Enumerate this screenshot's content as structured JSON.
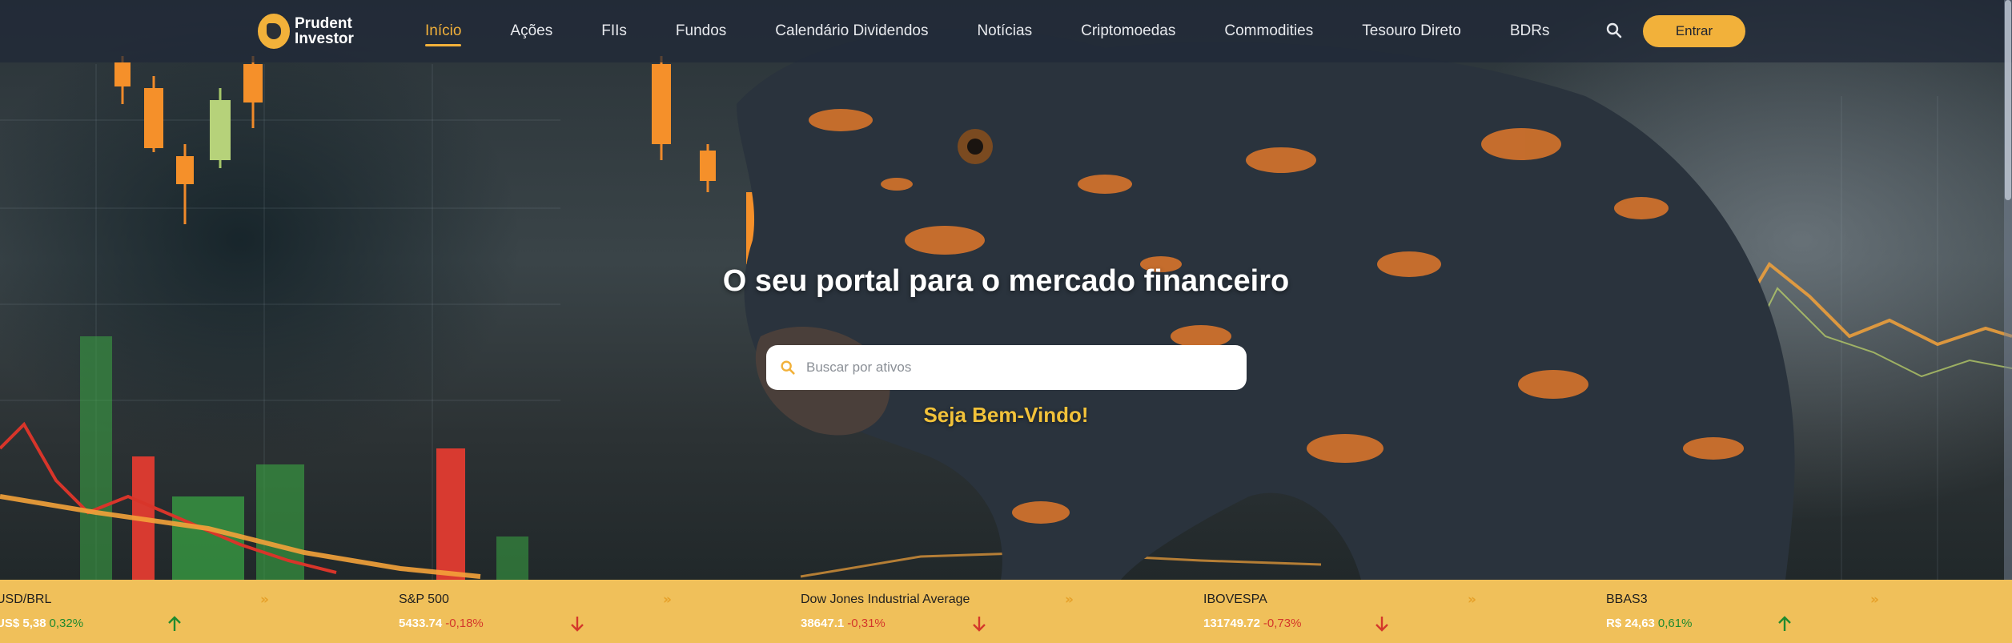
{
  "brand": {
    "line1": "Prudent",
    "line2": "Investor",
    "accent_color": "#f2b13a"
  },
  "nav": {
    "items": [
      {
        "label": "Início",
        "active": true
      },
      {
        "label": "Ações"
      },
      {
        "label": "FIIs"
      },
      {
        "label": "Fundos"
      },
      {
        "label": "Calendário Dividendos"
      },
      {
        "label": "Notícias"
      },
      {
        "label": "Criptomoedas"
      },
      {
        "label": "Commodities"
      },
      {
        "label": "Tesouro Direto"
      },
      {
        "label": "BDRs"
      }
    ],
    "search_icon": "search-icon",
    "login_label": "Entrar"
  },
  "hero": {
    "title": "O seu portal para o mercado financeiro",
    "search_placeholder": "Buscar por ativos",
    "welcome": "Seja Bem-Vindo!"
  },
  "ticker": {
    "items": [
      {
        "name": "USD/BRL",
        "price": "US$ 5,38",
        "change": "0,32%",
        "direction": "up"
      },
      {
        "name": "S&P 500",
        "price": "5433.74",
        "change": "-0,18%",
        "direction": "down"
      },
      {
        "name": "Dow Jones Industrial Average",
        "price": "38647.1",
        "change": "-0,31%",
        "direction": "down"
      },
      {
        "name": "IBOVESPA",
        "price": "131749.72",
        "change": "-0,73%",
        "direction": "down"
      },
      {
        "name": "BBAS3",
        "price": "R$ 24,63",
        "change": "0,61%",
        "direction": "up"
      }
    ],
    "colors": {
      "up": "#1f8a2e",
      "down": "#d4382b",
      "bar": "#f0c05a"
    }
  }
}
